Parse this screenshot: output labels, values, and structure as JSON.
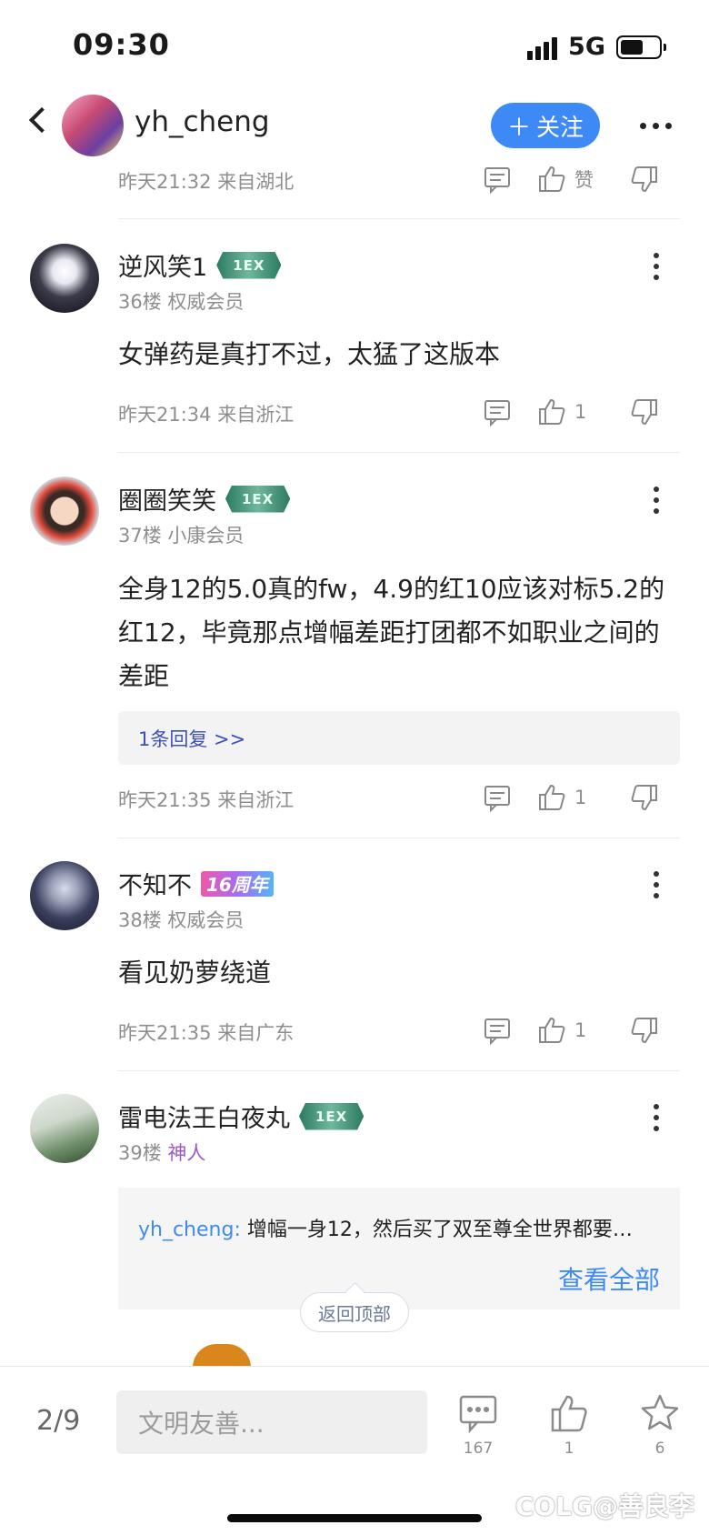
{
  "status_bar": {
    "time": "09:30",
    "network": "5G",
    "battery_level": 0.6
  },
  "header": {
    "username": "yh_cheng",
    "follow_label": "关注"
  },
  "top_meta": {
    "time_location": "昨天21:32 来自湖北",
    "like_label": "赞"
  },
  "posts": [
    {
      "username": "逆风笑1",
      "badge": "1EX",
      "floor_level": "36楼 权威会员",
      "content": "女弹药是真打不过，太猛了这版本",
      "meta": "昨天21:34 来自浙江",
      "likes": "1"
    },
    {
      "username": "圈圈笑笑",
      "badge": "1EX",
      "floor_level": "37楼 小康会员",
      "content": "全身12的5.0真的fw，4.9的红10应该对标5.2的红12，毕竟那点增幅差距打团都不如职业之间的差距",
      "reply_link": "1条回复 >>",
      "meta": "昨天21:35 来自浙江",
      "likes": "1"
    },
    {
      "username": "不知不",
      "badge": "16周年",
      "floor_level": "38楼 权威会员",
      "content": "看见奶萝绕道",
      "meta": "昨天21:35 来自广东",
      "likes": "1"
    },
    {
      "username": "雷电法王白夜丸",
      "badge": "1EX",
      "floor": "39楼",
      "level": "神人",
      "quote_user": "yh_cheng:",
      "quote_text": " 增幅一身12，然后买了双至尊全世界都要…",
      "view_all": "查看全部"
    }
  ],
  "back_to_top": "返回顶部",
  "bottom_bar": {
    "page_indicator": "2/9",
    "input_placeholder": "文明友善...",
    "comment_count": "167",
    "like_count": "1",
    "favorite_count": "6",
    "watermark": "COLG@善良李"
  },
  "colors": {
    "accent": "#3d8af7",
    "level_purple": "#9a57c8",
    "reply_link": "#3f51b5"
  }
}
